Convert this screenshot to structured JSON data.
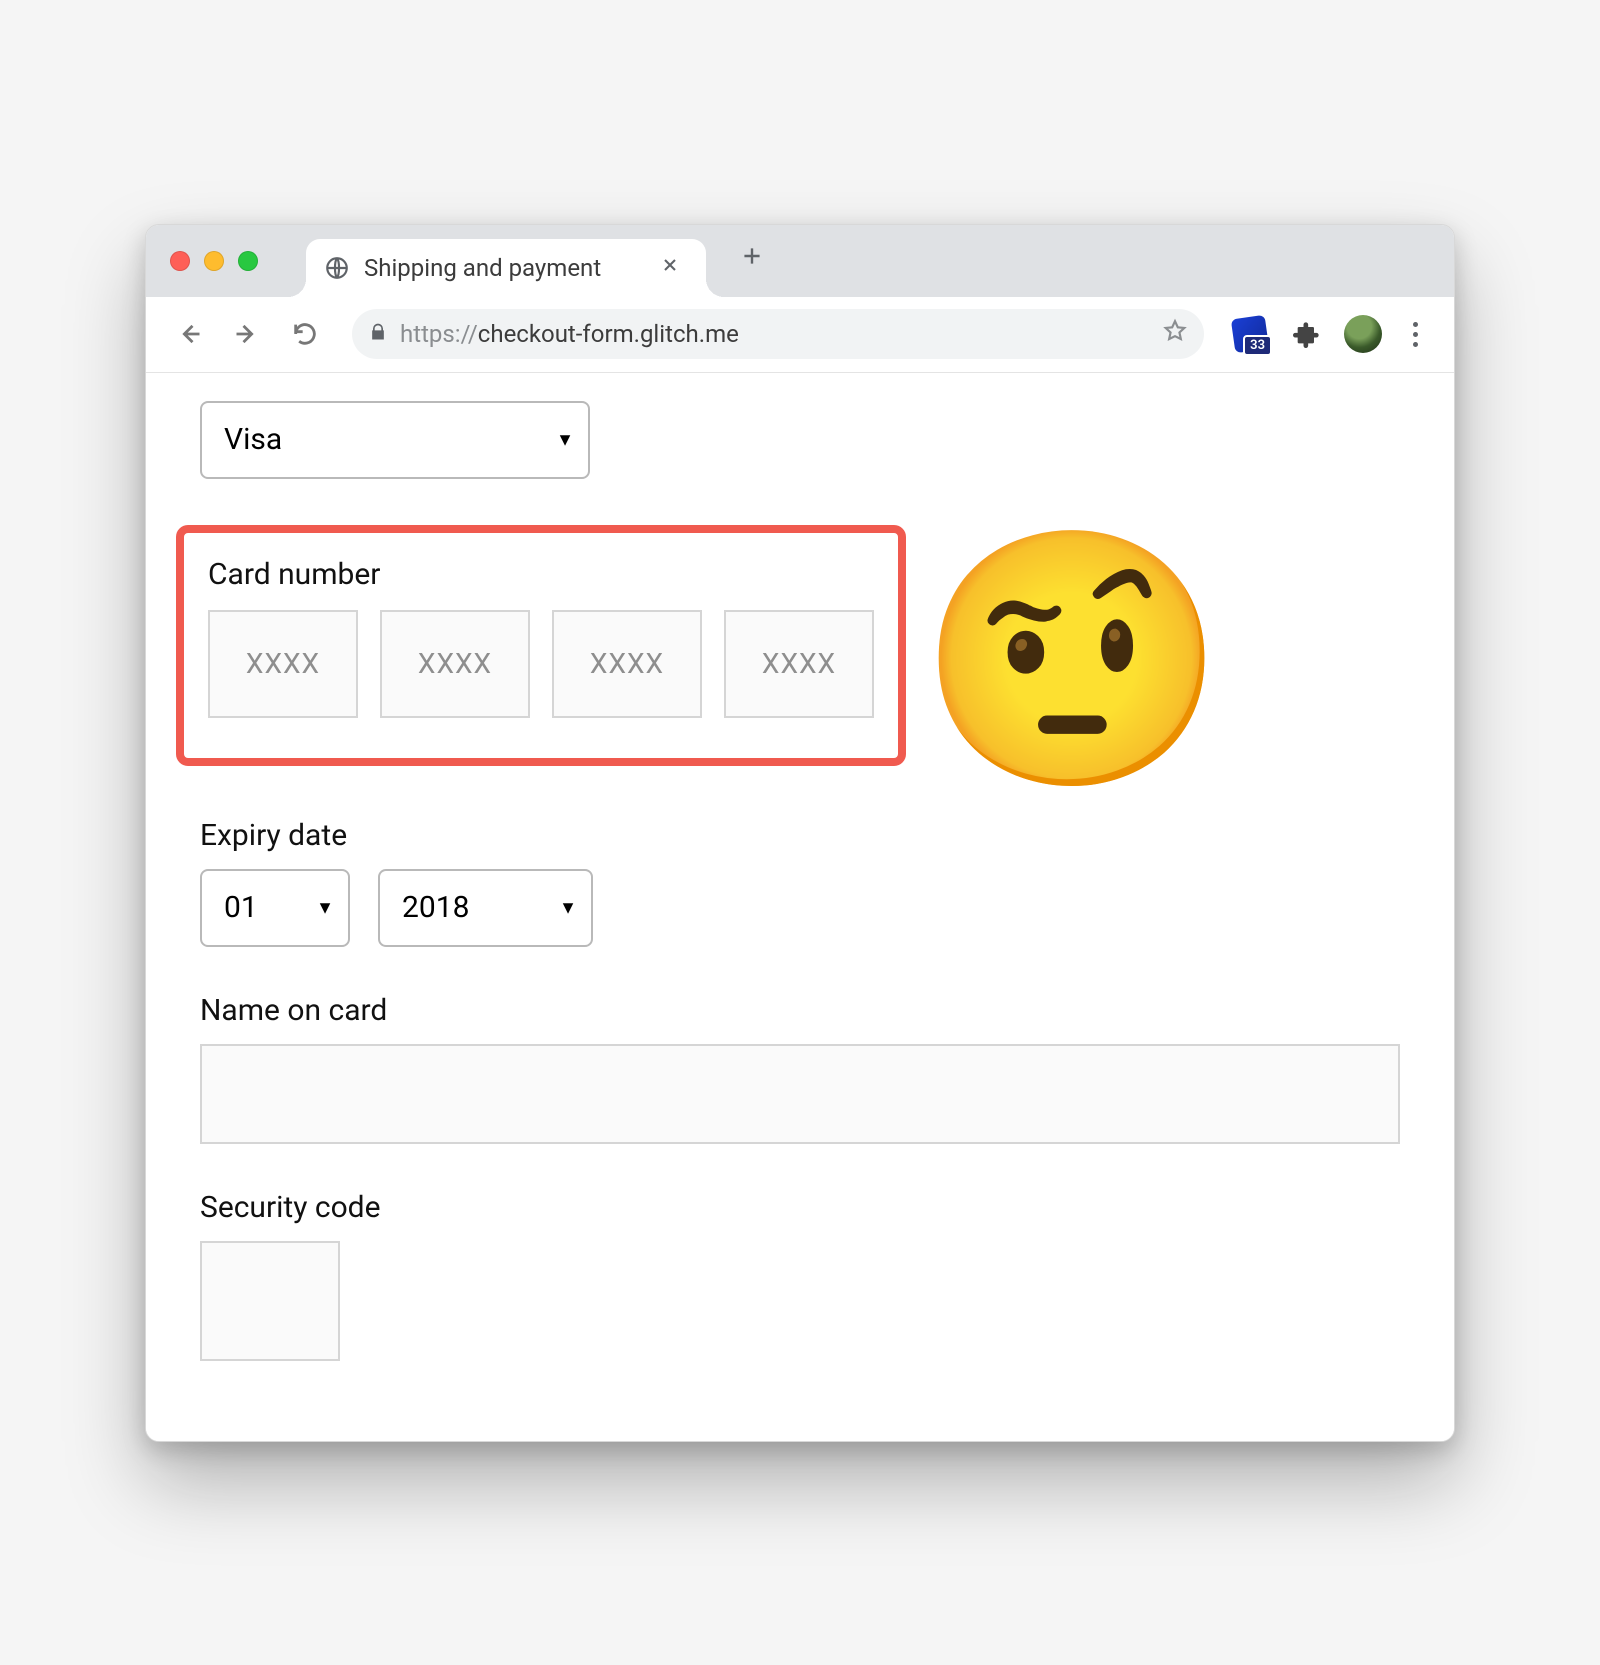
{
  "window": {
    "tab_title": "Shipping and payment",
    "url_protocol": "https://",
    "url_rest": "checkout-form.glitch.me",
    "extension_badge_count": "33"
  },
  "form": {
    "card_type": {
      "selected": "Visa"
    },
    "card_number": {
      "label": "Card number",
      "seg_placeholder": "XXXX",
      "emoji": "🤨"
    },
    "expiry": {
      "label": "Expiry date",
      "month": "01",
      "year": "2018"
    },
    "name": {
      "label": "Name on card",
      "value": ""
    },
    "security": {
      "label": "Security code",
      "value": ""
    }
  }
}
